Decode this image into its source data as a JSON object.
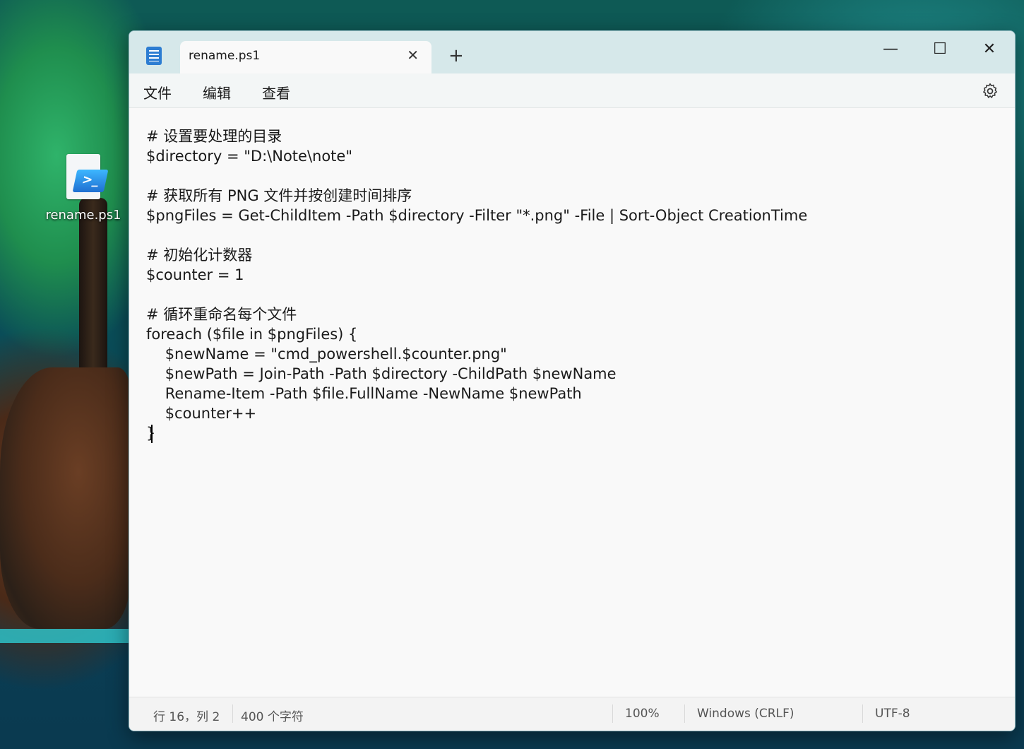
{
  "desktop": {
    "icon_label": "rename.ps1"
  },
  "tab": {
    "title": "rename.ps1",
    "close_glyph": "✕",
    "new_tab_glyph": "+"
  },
  "window_controls": {
    "minimize": "—",
    "maximize": "☐",
    "close": "✕"
  },
  "menu": {
    "file": "文件",
    "edit": "编辑",
    "view": "查看"
  },
  "editor": {
    "lines": [
      "# 设置要处理的目录",
      "$directory = \"D:\\Note\\note\"",
      "",
      "# 获取所有 PNG 文件并按创建时间排序",
      "$pngFiles = Get-ChildItem -Path $directory -Filter \"*.png\" -File | Sort-Object CreationTime",
      "",
      "# 初始化计数器",
      "$counter = 1",
      "",
      "# 循环重命名每个文件",
      "foreach ($file in $pngFiles) {",
      "    $newName = \"cmd_powershell.$counter.png\"",
      "    $newPath = Join-Path -Path $directory -ChildPath $newName",
      "    Rename-Item -Path $file.FullName -NewName $newPath",
      "    $counter++",
      "}"
    ]
  },
  "status": {
    "position": "行 16，列 2",
    "chars": "400 个字符",
    "zoom": "100%",
    "line_ending": "Windows (CRLF)",
    "encoding": "UTF-8"
  },
  "icons": [
    "notepad-app-icon",
    "settings-gear-icon",
    "powershell-file-icon"
  ]
}
